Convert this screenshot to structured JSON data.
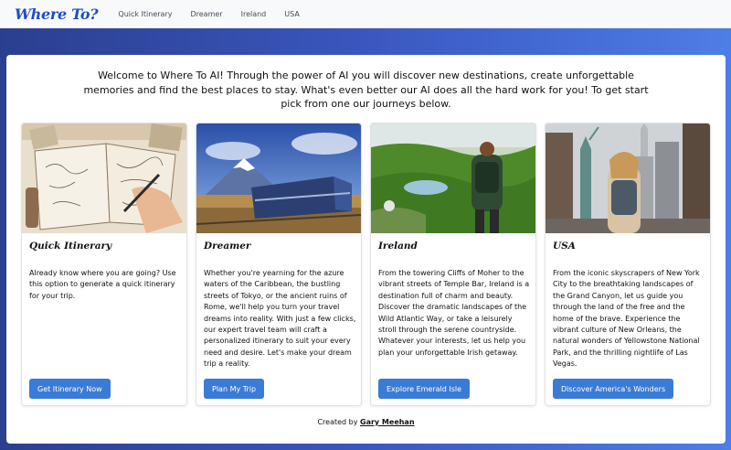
{
  "nav": {
    "brand": "Where To?",
    "links": [
      "Quick Itinerary",
      "Dreamer",
      "Ireland",
      "USA"
    ]
  },
  "intro": "Welcome to Where To AI! Through the power of AI you will discover new destinations, create unforgettable memories and find the best places to stay. What's even better our AI does all the hard work for you! To get start pick from one our journeys below.",
  "cards": [
    {
      "title": "Quick Itinerary",
      "text": "Already know where you are going? Use this option to generate a quick itinerary for your trip.",
      "button": "Get Itinerary Now"
    },
    {
      "title": "Dreamer",
      "text": "Whether you're yearning for the azure waters of the Caribbean, the bustling streets of Tokyo, or the ancient ruins of Rome, we'll help you turn your travel dreams into reality. With just a few clicks, our expert travel team will craft a personalized itinerary to suit your every need and desire. Let's make your dream trip a reality.",
      "button": "Plan My Trip"
    },
    {
      "title": "Ireland",
      "text": "From the towering Cliffs of Moher to the vibrant streets of Temple Bar, Ireland is a destination full of charm and beauty. Discover the dramatic landscapes of the Wild Atlantic Way, or take a leisurely stroll through the serene countryside. Whatever your interests, let us help you plan your unforgettable Irish getaway.",
      "button": "Explore Emerald Isle"
    },
    {
      "title": "USA",
      "text": "From the iconic skyscrapers of New York City to the breathtaking landscapes of the Grand Canyon, let us guide you through the land of the free and the home of the brave. Experience the vibrant culture of New Orleans, the natural wonders of Yellowstone National Park, and the thrilling nightlife of Las Vegas.",
      "button": "Discover America's Wonders"
    }
  ],
  "footer": {
    "prefix": "Created by",
    "author": "Gary Meehan"
  },
  "colors": {
    "brand": "#1f4fbf",
    "button": "#3a7bd5",
    "background_gradient_start": "#2b3f8f",
    "background_gradient_end": "#4d7ee6"
  }
}
